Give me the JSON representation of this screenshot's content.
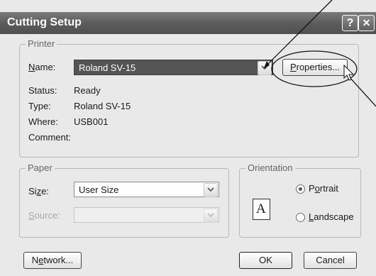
{
  "window": {
    "title": "Cutting Setup",
    "help_glyph": "?",
    "close_glyph": "✕"
  },
  "printer": {
    "legend": "Printer",
    "name_label": "Name:",
    "name_value": "Roland SV-15",
    "properties_label": "Properties...",
    "status_label": "Status:",
    "status_value": "Ready",
    "type_label": "Type:",
    "type_value": "Roland SV-15",
    "where_label": "Where:",
    "where_value": "USB001",
    "comment_label": "Comment:",
    "comment_value": ""
  },
  "paper": {
    "legend": "Paper",
    "size_label": "Size:",
    "size_value": "User Size",
    "source_label": "Source:",
    "source_value": ""
  },
  "orientation": {
    "legend": "Orientation",
    "portrait_label": "Portrait",
    "landscape_label": "Landscape",
    "selected": "Portrait",
    "page_icon_letter": "A"
  },
  "buttons": {
    "network": "Network...",
    "ok": "OK",
    "cancel": "Cancel"
  },
  "colors": {
    "title_bar": "#5c5c5c",
    "selection": "#545454",
    "dialog_bg": "#e9e9e9"
  }
}
